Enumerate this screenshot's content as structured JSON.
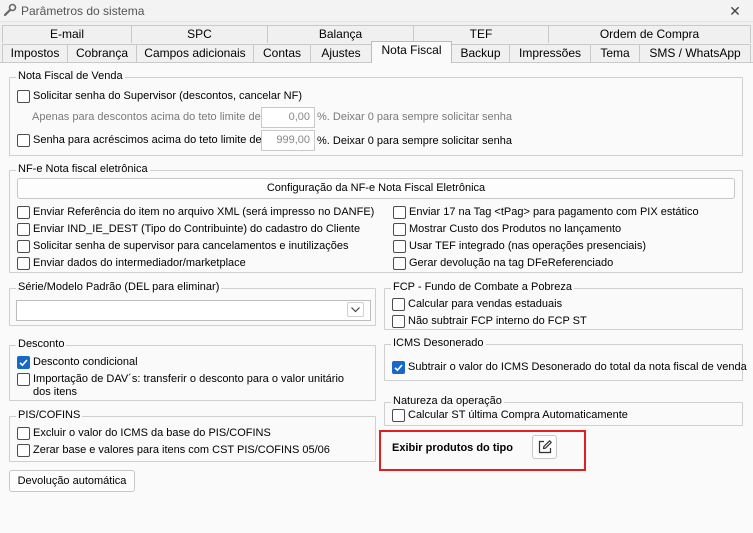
{
  "window": {
    "title": "Parâmetros do sistema",
    "close_glyph": "✕",
    "icon": "wrench-icon"
  },
  "tabs_top": [
    "E-mail",
    "SPC",
    "Balança",
    "TEF",
    "Ordem de Compra"
  ],
  "tabs_bottom": [
    "Impostos",
    "Cobrança",
    "Campos adicionais",
    "Contas",
    "Ajustes",
    "Nota Fiscal",
    "Backup",
    "Impressões",
    "Tema",
    "SMS / WhatsApp"
  ],
  "active_tab": "Nota Fiscal",
  "nf_venda": {
    "legend": "Nota Fiscal de Venda",
    "opt_senha_supervisor": "Solicitar senha do Supervisor (descontos, cancelar NF)",
    "descontos_label": "Apenas para descontos acima do teto limite de:",
    "descontos_value": "0,00",
    "descontos_suffix": "%. Deixar 0 para sempre solicitar senha",
    "opt_acrescimos": "Senha para acréscimos acima do teto limite de:",
    "acrescimos_value": "999,00",
    "acrescimos_suffix": "%. Deixar 0 para sempre solicitar senha"
  },
  "nfe": {
    "legend": "NF-e Nota fiscal eletrônica",
    "config_button": "Configuração da NF-e Nota Fiscal Eletrônica",
    "left": [
      "Enviar Referência do item no arquivo XML (será impresso no DANFE)",
      "Enviar IND_IE_DEST (Tipo do Contribuinte) do cadastro do Cliente",
      "Solicitar senha de supervisor para cancelamentos e inutilizações",
      "Enviar dados do intermediador/marketplace"
    ],
    "right": [
      "Enviar 17 na Tag <tPag> para pagamento com PIX estático",
      "Mostrar Custo dos Produtos no lançamento",
      "Usar TEF integrado (nas operações presenciais)",
      "Gerar devolução na tag DFeReferenciado"
    ]
  },
  "serie": {
    "legend": "Série/Modelo Padrão (DEL para eliminar)",
    "value": ""
  },
  "fcp": {
    "legend": "FCP - Fundo de Combate a Pobreza",
    "opt1": "Calcular para vendas estaduais",
    "opt2": "Não subtrair FCP interno do FCP ST"
  },
  "desconto": {
    "legend": "Desconto",
    "opt1": "Desconto condicional",
    "opt2": "Importação de DAV´s: transferir o desconto para o valor unitário dos itens"
  },
  "icms": {
    "legend": "ICMS Desonerado",
    "opt1": "Subtrair o valor do ICMS Desonerado do total da nota fiscal de venda"
  },
  "piscofins": {
    "legend": "PIS/COFINS",
    "opt1": "Excluir o valor do ICMS da base do PIS/COFINS",
    "opt2": "Zerar base e valores para itens com CST PIS/COFINS 05/06"
  },
  "natureza": {
    "legend": "Natureza da operação",
    "opt1": "Calcular ST última Compra Automaticamente"
  },
  "exibir": {
    "label": "Exibir produtos do tipo",
    "edit_icon": "edit-icon"
  },
  "devolucao_button": "Devolução automática",
  "colors": {
    "check_blue": "#1868c8",
    "highlight_red": "#e02020"
  }
}
